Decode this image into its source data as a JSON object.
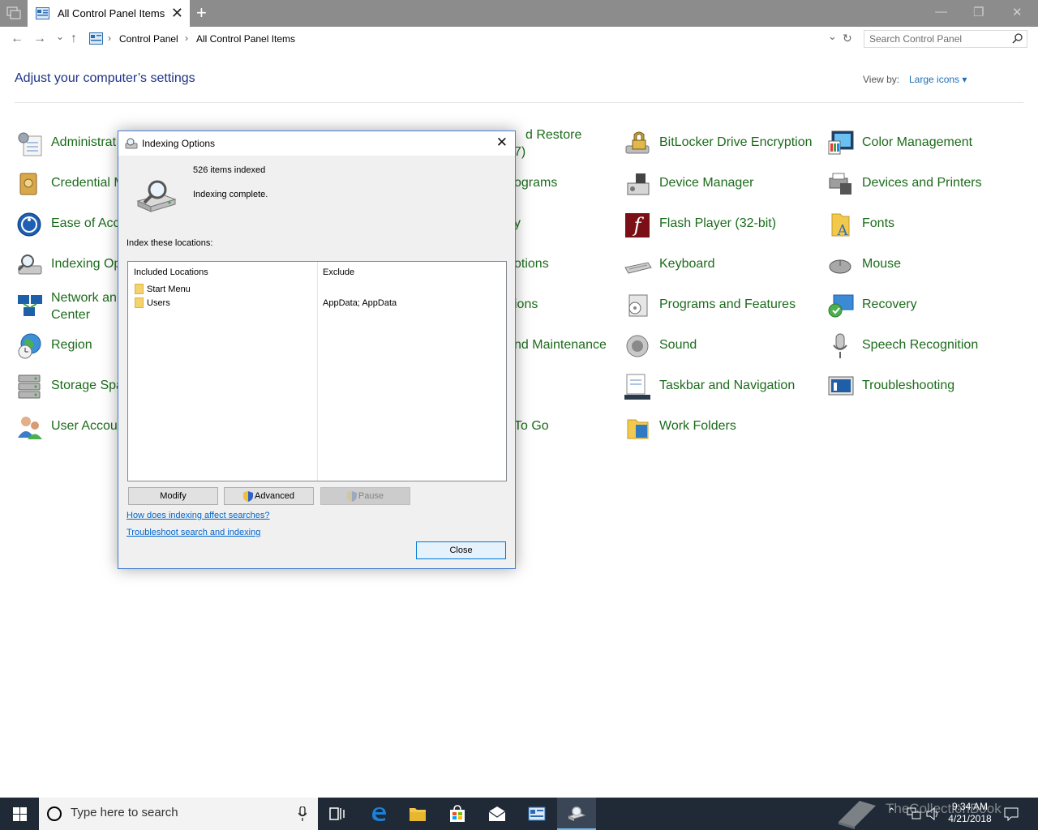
{
  "window": {
    "tab_title": "All Control Panel Items",
    "tab_close": "✕",
    "new_tab": "+",
    "minimize": "—",
    "maximize": "❐",
    "close": "✕"
  },
  "addressbar": {
    "back": "←",
    "forward": "→",
    "recent": "⌄",
    "up": "↑",
    "crumbs": [
      "Control Panel",
      "All Control Panel Items"
    ],
    "separator": "›",
    "dropdown": "⌄",
    "refresh": "↻",
    "search_placeholder": "Search Control Panel"
  },
  "header": {
    "title": "Adjust your computer’s settings",
    "view_by_label": "View by:",
    "view_by_value": "Large icons ▾"
  },
  "items": {
    "col1": [
      {
        "label": "Administrat",
        "icon": "admin-tools-icon"
      },
      {
        "label": "Credential M",
        "icon": "credential-manager-icon"
      },
      {
        "label": "Ease of Acce",
        "icon": "ease-of-access-icon"
      },
      {
        "label": "Indexing Op",
        "icon": "indexing-options-icon"
      },
      {
        "label": "Network an",
        "label2": "Center",
        "icon": "network-icon"
      },
      {
        "label": "Region",
        "icon": "region-icon"
      },
      {
        "label": "Storage Spa",
        "icon": "storage-spaces-icon"
      },
      {
        "label": "User Accour",
        "icon": "user-accounts-icon"
      }
    ],
    "col3": [
      {
        "label": "d Restore",
        "label2": "7)",
        "icon": ""
      },
      {
        "label": "ograms",
        "icon": ""
      },
      {
        "label": "y",
        "icon": ""
      },
      {
        "label": "otions",
        "icon": ""
      },
      {
        "label": "ions",
        "icon": ""
      },
      {
        "label": "nd Maintenance",
        "icon": ""
      },
      {
        "label": "",
        "icon": ""
      },
      {
        "label": "To Go",
        "icon": ""
      }
    ],
    "col4": [
      {
        "label": "BitLocker Drive Encryption",
        "icon": "bitlocker-icon"
      },
      {
        "label": "Device Manager",
        "icon": "device-manager-icon"
      },
      {
        "label": "Flash Player (32-bit)",
        "icon": "flash-player-icon"
      },
      {
        "label": "Keyboard",
        "icon": "keyboard-icon"
      },
      {
        "label": "Programs and Features",
        "icon": "programs-features-icon"
      },
      {
        "label": "Sound",
        "icon": "sound-icon"
      },
      {
        "label": "Taskbar and Navigation",
        "icon": "taskbar-icon"
      },
      {
        "label": "Work Folders",
        "icon": "work-folders-icon"
      }
    ],
    "col5": [
      {
        "label": "Color Management",
        "icon": "color-management-icon"
      },
      {
        "label": "Devices and Printers",
        "icon": "devices-printers-icon"
      },
      {
        "label": "Fonts",
        "icon": "fonts-icon"
      },
      {
        "label": "Mouse",
        "icon": "mouse-icon"
      },
      {
        "label": "Recovery",
        "icon": "recovery-icon"
      },
      {
        "label": "Speech Recognition",
        "icon": "speech-recognition-icon"
      },
      {
        "label": "Troubleshooting",
        "icon": "troubleshooting-icon"
      }
    ]
  },
  "dialog": {
    "title": "Indexing Options",
    "close": "✕",
    "items_indexed": "526 items indexed",
    "status": "Indexing complete.",
    "locations_label": "Index these locations:",
    "col_included": "Included Locations",
    "col_exclude": "Exclude",
    "rows": [
      {
        "location": "Start Menu",
        "exclude": ""
      },
      {
        "location": "Users",
        "exclude": "AppData; AppData"
      }
    ],
    "btn_modify": "Modify",
    "btn_advanced": "Advanced",
    "btn_pause": "Pause",
    "link_how": "How does indexing affect searches?",
    "link_troubleshoot": "Troubleshoot search and indexing",
    "btn_close": "Close"
  },
  "taskbar": {
    "search_placeholder": "Type here to search",
    "time": "9:34 AM",
    "date": "4/21/2018",
    "watermark": "TheCollectionBook"
  }
}
